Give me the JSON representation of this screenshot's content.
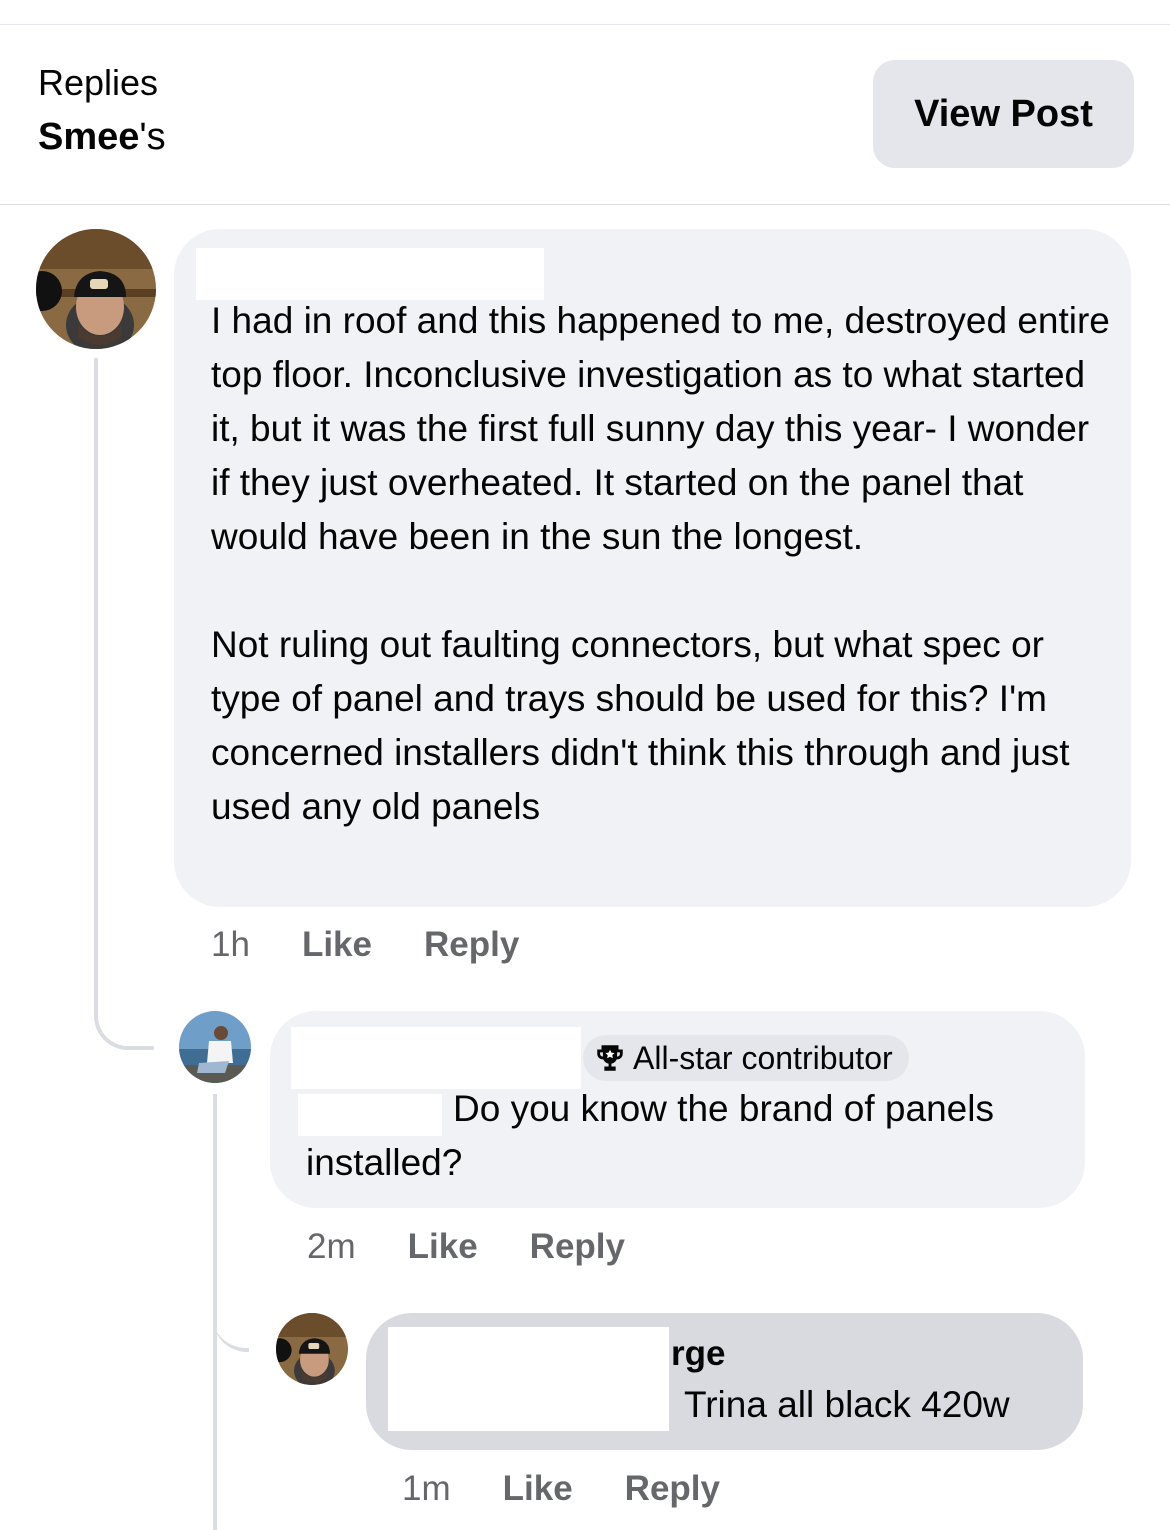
{
  "header": {
    "replies_label": "Replies",
    "title_name": "Smee",
    "title_suffix": "'s",
    "view_post_label": "View Post"
  },
  "comments": [
    {
      "text_p1": "I had in roof and this happened to me, destroyed entire top floor. Inconclusive investigation as to what started it, but it was the first full sunny day this year- I wonder if they just overheated. It started on the panel that would have been in the sun the longest.",
      "text_p2": "Not ruling out faulting connectors, but what spec or type of panel and trays should be used for this? I'm concerned installers didn't think this through and just used any old panels",
      "time": "1h",
      "like_label": "Like",
      "reply_label": "Reply"
    },
    {
      "badge": "All-star contributor",
      "text_line1": "Do you know the brand of panels",
      "text_line2": "installed?",
      "time": "2m",
      "like_label": "Like",
      "reply_label": "Reply"
    },
    {
      "name_fragment": "rge",
      "text": "Trina all black 420w",
      "time": "1m",
      "like_label": "Like",
      "reply_label": "Reply"
    }
  ],
  "icons": {
    "badge_icon": "trophy-icon"
  },
  "colors": {
    "bubble": "#f0f2f5",
    "bubble_active": "#d8dadf",
    "meta_text": "#65676b",
    "button_bg": "#e4e6eb"
  }
}
